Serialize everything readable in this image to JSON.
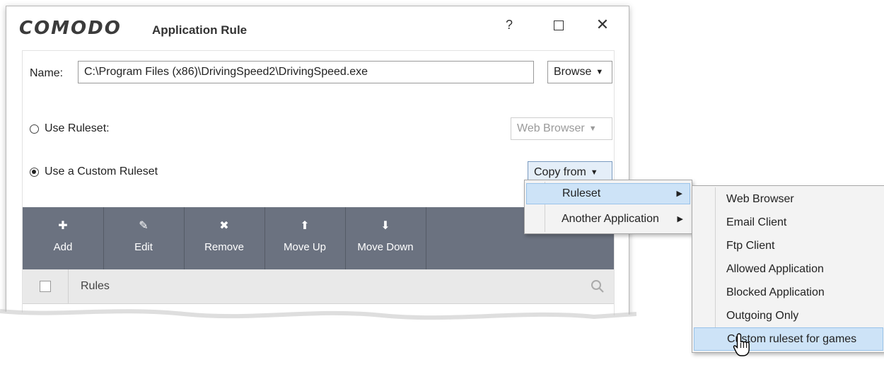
{
  "window": {
    "brand": "COMODO",
    "title": "Application Rule",
    "help_label": "?",
    "close_label": "✕"
  },
  "form": {
    "name_label": "Name:",
    "name_value": "C:\\Program Files (x86)\\DrivingSpeed2\\DrivingSpeed.exe",
    "browse_label": "Browse",
    "use_ruleset_label": "Use Ruleset:",
    "ruleset_selected": "Web Browser",
    "use_custom_label": "Use a Custom Ruleset",
    "copy_from_label": "Copy from"
  },
  "toolbar": {
    "add": "Add",
    "edit": "Edit",
    "remove": "Remove",
    "move_up": "Move Up",
    "move_down": "Move Down"
  },
  "rules": {
    "header": "Rules"
  },
  "copy_menu": {
    "items": [
      "Ruleset",
      "Another Application"
    ]
  },
  "ruleset_menu": {
    "items": [
      "Web Browser",
      "Email Client",
      "Ftp Client",
      "Allowed Application",
      "Blocked Application",
      "Outgoing Only",
      "Custom ruleset for games"
    ]
  }
}
